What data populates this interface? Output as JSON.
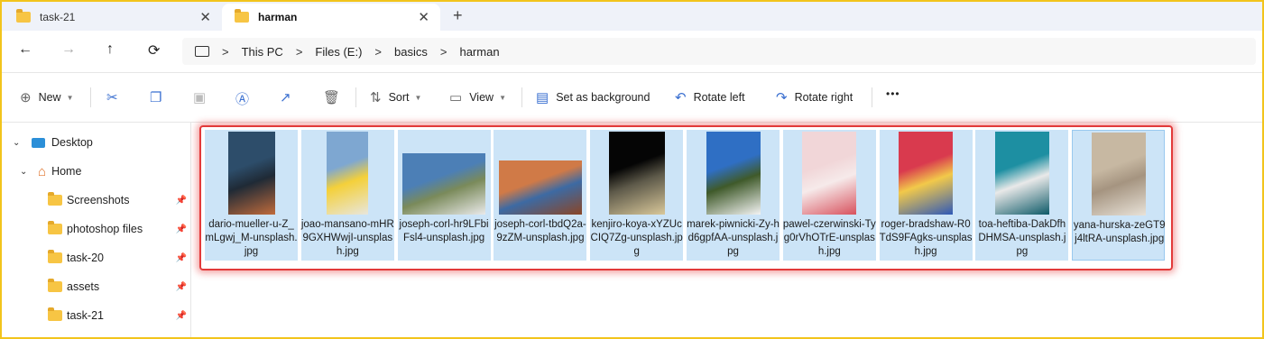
{
  "tabs": [
    {
      "label": "task-21",
      "active": false
    },
    {
      "label": "harman",
      "active": true
    }
  ],
  "tab_close_glyph": "✕",
  "new_tab_glyph": "+",
  "nav": {
    "back": "←",
    "forward": "→",
    "up": "↑",
    "refresh": "⟳"
  },
  "breadcrumb": [
    "This PC",
    "Files (E:)",
    "basics",
    "harman"
  ],
  "breadcrumb_sep": ">",
  "toolbar": {
    "new_label": "New",
    "sort_label": "Sort",
    "view_label": "View",
    "set_background_label": "Set as background",
    "rotate_left_label": "Rotate left",
    "rotate_right_label": "Rotate right",
    "more_label": "•••"
  },
  "sidebar": {
    "desktop": "Desktop",
    "home": "Home",
    "items": [
      "Screenshots",
      "photoshop files",
      "task-20",
      "assets",
      "task-21"
    ]
  },
  "files": [
    {
      "name": "dario-mueller-u-Z_mLgwj_M-unsplash.jpg",
      "colors": [
        "#2d4d6a",
        "#c06b3c",
        "#1f2a36"
      ]
    },
    {
      "name": "joao-mansano-mHR9GXHWwjI-unsplash.jpg",
      "colors": [
        "#7ea7d1",
        "#e8e6dd",
        "#f4d03a"
      ]
    },
    {
      "name": "joseph-corl-hr9LFbiFsl4-unsplash.jpg",
      "colors": [
        "#4c7fb6",
        "#eaeaea",
        "#7a8a5a"
      ]
    },
    {
      "name": "joseph-corl-tbdQ2a-9zZM-unsplash.jpg",
      "colors": [
        "#d07a47",
        "#8a4526",
        "#3d6aa3"
      ]
    },
    {
      "name": "kenjiro-koya-xYZUcCIQ7Zg-unsplash.jpg",
      "colors": [
        "#050505",
        "#d9c89a",
        "#5e5a4a"
      ]
    },
    {
      "name": "marek-piwnicki-Zy-hd6gpfAA-unsplash.jpg",
      "colors": [
        "#2f6fc4",
        "#f4f4f4",
        "#3f5a2a"
      ]
    },
    {
      "name": "pawel-czerwinski-Tyg0rVhOTrE-unsplash.jpg",
      "colors": [
        "#f1d6d8",
        "#d8525e",
        "#f6eaea"
      ]
    },
    {
      "name": "roger-bradshaw-R0TdS9FAgks-unsplash.jpg",
      "colors": [
        "#d93a4e",
        "#2f59b8",
        "#f2c94a"
      ]
    },
    {
      "name": "toa-heftiba-DakDfhDHMSA-unsplash.jpg",
      "colors": [
        "#1d8fa2",
        "#0d5a68",
        "#e9e9e9"
      ]
    },
    {
      "name": "yana-hurska-zeGT9j4ltRA-unsplash.jpg",
      "colors": [
        "#c7b8a2",
        "#e8e2d8",
        "#a59480"
      ]
    }
  ],
  "accent": "#cce4f7",
  "highlight": "#e23a3a"
}
